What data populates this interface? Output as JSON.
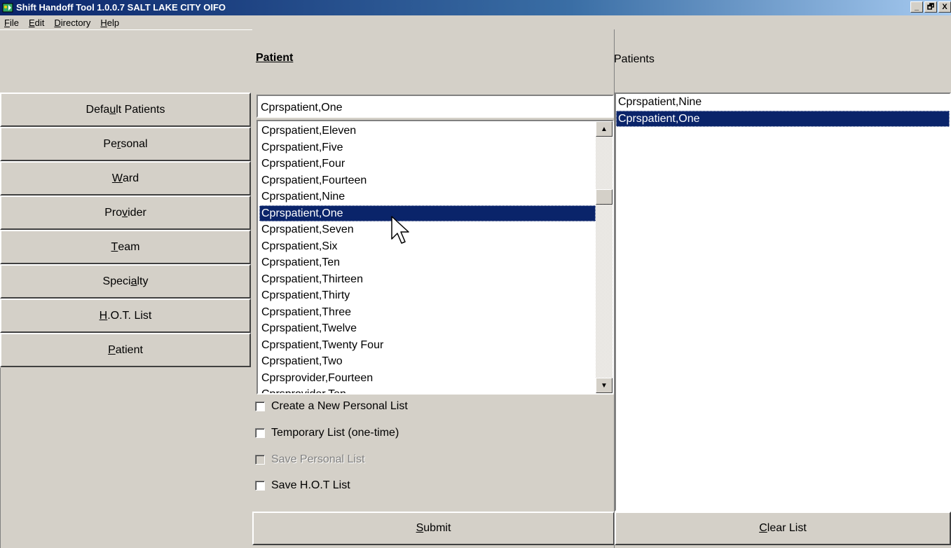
{
  "window": {
    "title": "Shift Handoff Tool 1.0.0.7  SALT LAKE CITY OIFO",
    "minimize": "_",
    "restore": "🗗",
    "close": "X"
  },
  "menu": [
    {
      "pre": "",
      "acc": "F",
      "post": "ile"
    },
    {
      "pre": "",
      "acc": "E",
      "post": "dit"
    },
    {
      "pre": "",
      "acc": "D",
      "post": "irectory"
    },
    {
      "pre": "",
      "acc": "H",
      "post": "elp"
    }
  ],
  "nav": [
    {
      "name": "default-patients",
      "pre": "Defa",
      "acc": "u",
      "post": "lt Patients"
    },
    {
      "name": "personal",
      "pre": "Pe",
      "acc": "r",
      "post": "sonal"
    },
    {
      "name": "ward",
      "pre": "",
      "acc": "W",
      "post": "ard"
    },
    {
      "name": "provider",
      "pre": "Pro",
      "acc": "v",
      "post": "ider"
    },
    {
      "name": "team",
      "pre": "",
      "acc": "T",
      "post": "eam"
    },
    {
      "name": "specialty",
      "pre": "Speci",
      "acc": "a",
      "post": "lty"
    },
    {
      "name": "hot-list",
      "pre": "",
      "acc": "H",
      "post": ".O.T. List"
    },
    {
      "name": "patient",
      "pre": "",
      "acc": "P",
      "post": "atient"
    }
  ],
  "patient_panel": {
    "title": "Patient",
    "search_value": "Cprspatient,One",
    "items": [
      "Cprspatient,Eleven",
      "Cprspatient,Five",
      "Cprspatient,Four",
      "Cprspatient,Fourteen",
      "Cprspatient,Nine",
      "Cprspatient,One",
      "Cprspatient,Seven",
      "Cprspatient,Six",
      "Cprspatient,Ten",
      "Cprspatient,Thirteen",
      "Cprspatient,Thirty",
      "Cprspatient,Three",
      "Cprspatient,Twelve",
      "Cprspatient,Twenty Four",
      "Cprspatient,Two",
      "Cprsprovider,Fourteen",
      "Cprsprovider,Ten"
    ],
    "selected_index": 5
  },
  "options": [
    {
      "label": "Create a New Personal List",
      "checked": false,
      "disabled": false
    },
    {
      "label": "Temporary List  (one-time)",
      "checked": false,
      "disabled": false
    },
    {
      "label": "Save Personal List",
      "checked": false,
      "disabled": true
    },
    {
      "label": "Save H.O.T List",
      "checked": false,
      "disabled": false
    }
  ],
  "submit": {
    "pre": "",
    "acc": "S",
    "post": "ubmit"
  },
  "right_panel": {
    "title": "Patients",
    "items": [
      "Cprspatient,Nine",
      "Cprspatient,One"
    ],
    "selected_index": 1
  },
  "clear": {
    "pre": "",
    "acc": "C",
    "post": "lear List"
  },
  "colors": {
    "selection": "#0a246a",
    "face": "#d4d0c8"
  }
}
